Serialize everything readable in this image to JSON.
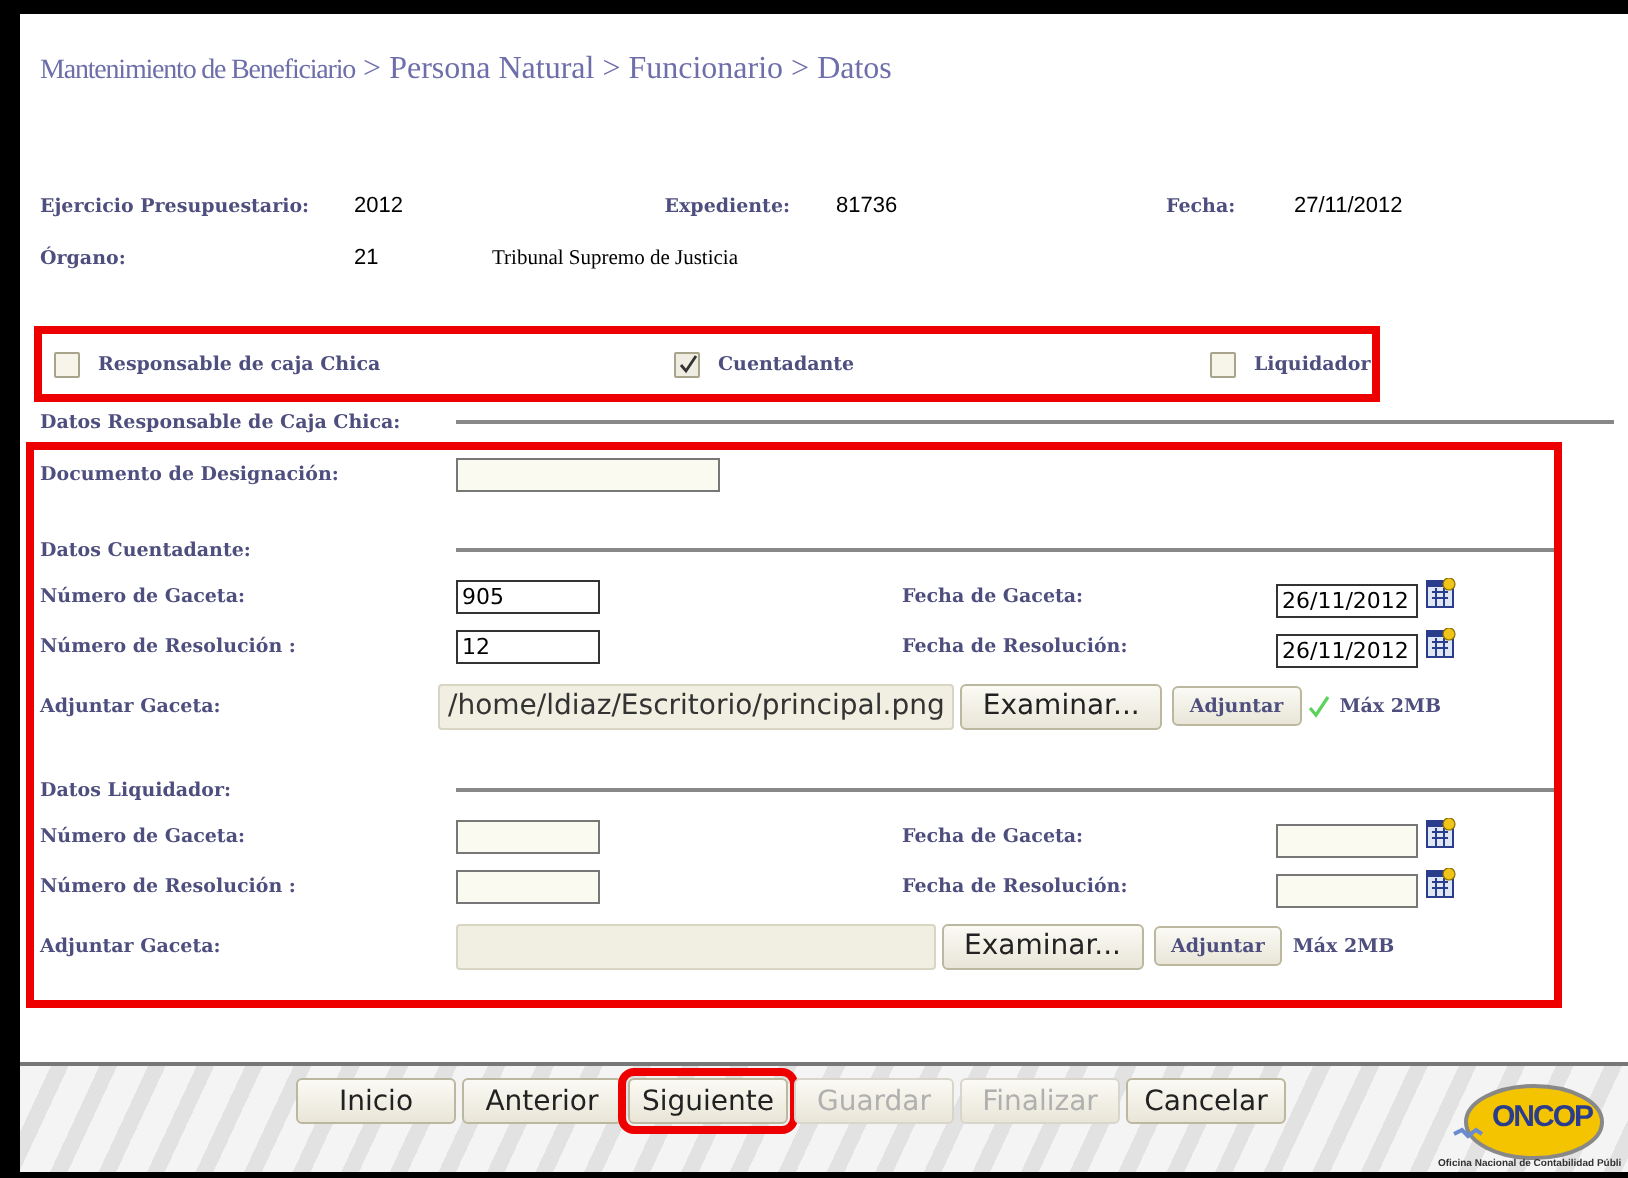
{
  "breadcrumb": [
    {
      "kind": "root",
      "text": "Mantenimiento de Beneficiario"
    },
    {
      "kind": "path",
      "text": "> Persona Natural > Funcionario > Datos"
    }
  ],
  "info": [
    [
      {
        "label": "Ejercicio Presupuestario:",
        "value": "2012"
      },
      {
        "label": "Expediente:",
        "value": "81736"
      },
      {
        "label": "Fecha:",
        "value": "27/11/2012"
      }
    ],
    [
      {
        "label": "Órgano:",
        "value": "21",
        "description": "Tribunal Supremo de Justicia"
      }
    ]
  ],
  "roles": {
    "highlighted": true,
    "items": [
      {
        "label": "Responsable de caja Chica",
        "checked": false
      },
      {
        "label": "Cuentadante",
        "checked": true
      },
      {
        "label": "Liquidador",
        "checked": false
      }
    ]
  },
  "sections_highlighted": true,
  "sections": [
    {
      "title": "Datos Responsable de Caja Chica:",
      "fields": [
        {
          "kind": "text",
          "label": "Documento de Designación:"
        }
      ]
    },
    {
      "title": "Datos Cuentadante:",
      "fields": [
        {
          "kind": "pair",
          "label": "Número de Gaceta:",
          "value": "905",
          "date_label": "Fecha de Gaceta:",
          "date_value": "26/11/2012"
        },
        {
          "kind": "pair",
          "label": "Número de Resolución :",
          "value": "12",
          "date_label": "Fecha de Resolución:",
          "date_value": "26/11/2012"
        },
        {
          "kind": "file",
          "label": "Adjuntar Gaceta:",
          "path": "/home/ldiaz/Escritorio/principal.png",
          "browse": "Examinar...",
          "attach": "Adjuntar",
          "uploaded": true,
          "note": "Máx 2MB"
        }
      ]
    },
    {
      "title": "Datos Liquidador:",
      "fields": [
        {
          "kind": "pair",
          "label": "Número de Gaceta:",
          "date_label": "Fecha de Gaceta:"
        },
        {
          "kind": "pair",
          "label": "Número de Resolución :",
          "date_label": "Fecha de Resolución:"
        },
        {
          "kind": "file",
          "label": "Adjuntar Gaceta:",
          "browse": "Examinar...",
          "attach": "Adjuntar",
          "uploaded": false,
          "note": "Máx 2MB"
        }
      ]
    }
  ],
  "buttons": [
    {
      "label": "Inicio",
      "disabled": false,
      "highlighted": false
    },
    {
      "label": "Anterior",
      "disabled": false,
      "highlighted": false
    },
    {
      "label": "Siguiente",
      "disabled": false,
      "highlighted": true
    },
    {
      "label": "Guardar",
      "disabled": true,
      "highlighted": false
    },
    {
      "label": "Finalizar",
      "disabled": true,
      "highlighted": false
    },
    {
      "label": "Cancelar",
      "disabled": false,
      "highlighted": false
    }
  ],
  "logo": {
    "name": "ONCOP",
    "caption": "Oficina Nacional de Contabilidad Públi"
  }
}
